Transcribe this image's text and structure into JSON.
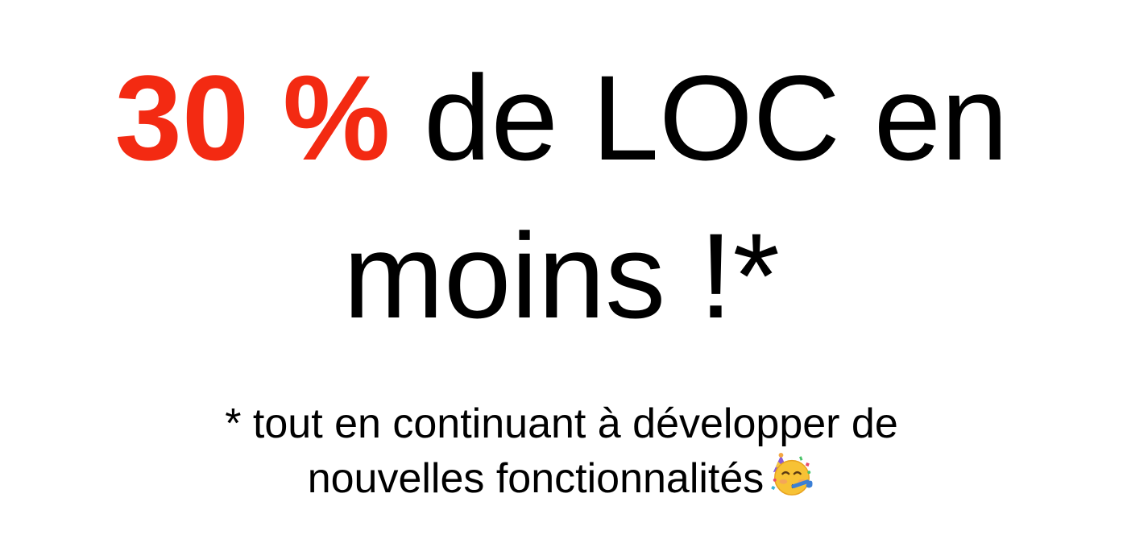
{
  "headline": {
    "highlight": "30 %",
    "line1_rest": " de LOC en",
    "line2": "moins !*"
  },
  "footnote": {
    "line1": "* tout en continuant à développer de",
    "line2": "nouvelles fonctionnalités"
  },
  "colors": {
    "highlight": "#f32a12",
    "text": "#000000",
    "background": "#ffffff"
  },
  "icons": {
    "footnote_emoji": "partying-face-icon"
  }
}
